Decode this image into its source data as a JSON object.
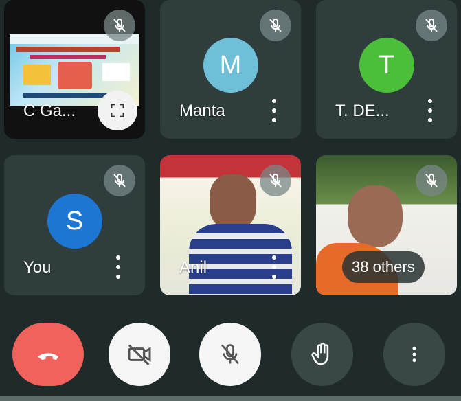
{
  "tiles": [
    {
      "name": "C Ga...",
      "type": "screen-share",
      "muted": true
    },
    {
      "name": "Manta",
      "initial": "M",
      "avatar_color": "#6fbfd8",
      "muted": true
    },
    {
      "name": "T. DE...",
      "initial": "T",
      "avatar_color": "#4cbf3a",
      "muted": true
    },
    {
      "name": "You",
      "initial": "S",
      "avatar_color": "#1d76d2",
      "muted": true
    },
    {
      "name": "Anil",
      "type": "video",
      "muted": true
    },
    {
      "type": "video",
      "muted": true
    }
  ],
  "others_pill": "38 others",
  "controls": {
    "end_call": "end-call",
    "camera": "camera-off",
    "mic": "mic-off",
    "hand": "raise-hand",
    "more": "more-options"
  },
  "colors": {
    "end_call": "#f0625b",
    "tile_bg": "#2f3d3c",
    "page_bg": "#1f2a2a"
  }
}
